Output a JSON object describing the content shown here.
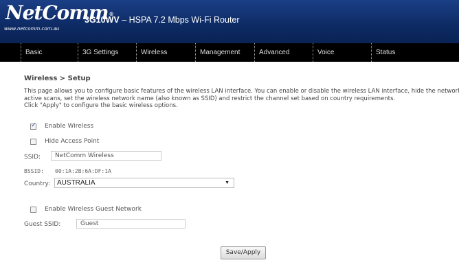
{
  "header": {
    "logo_text": "NetComm",
    "logo_mark": "®",
    "logo_url": "www.netcomm.com.au",
    "model_bold": "3G10WV",
    "model_rest": " – HSPA 7.2 Mbps Wi-Fi Router",
    "background_color": "#0d2a63"
  },
  "nav": {
    "items": [
      {
        "label": "Basic"
      },
      {
        "label": "3G Settings"
      },
      {
        "label": "Wireless"
      },
      {
        "label": "Management"
      },
      {
        "label": "Advanced"
      },
      {
        "label": "Voice"
      },
      {
        "label": "Status"
      }
    ]
  },
  "page": {
    "breadcrumb": "Wireless > Setup",
    "description_line1": "This page allows you to configure basic features of the wireless LAN interface. You can enable or disable the wireless LAN interface, hide the network from",
    "description_line2": "active scans, set the wireless network name (also known as SSID) and restrict the channel set based on country requirements.",
    "description_line3": "Click \"Apply\" to configure the basic wireless options."
  },
  "form": {
    "enable_wireless_label": "Enable Wireless",
    "enable_wireless_checked": true,
    "hide_ap_label": "Hide Access Point",
    "hide_ap_checked": false,
    "ssid_label": "SSID:",
    "ssid_value": "NetComm Wireless",
    "bssid_label": "BSSID:",
    "bssid_value": "00:1A:2B:6A:DF:1A",
    "country_label": "Country:",
    "country_value": "AUSTRALIA",
    "guest_label": "Enable Wireless Guest Network",
    "guest_checked": false,
    "guest_ssid_label": "Guest SSID:",
    "guest_ssid_value": "Guest",
    "save_label": "Save/Apply"
  }
}
